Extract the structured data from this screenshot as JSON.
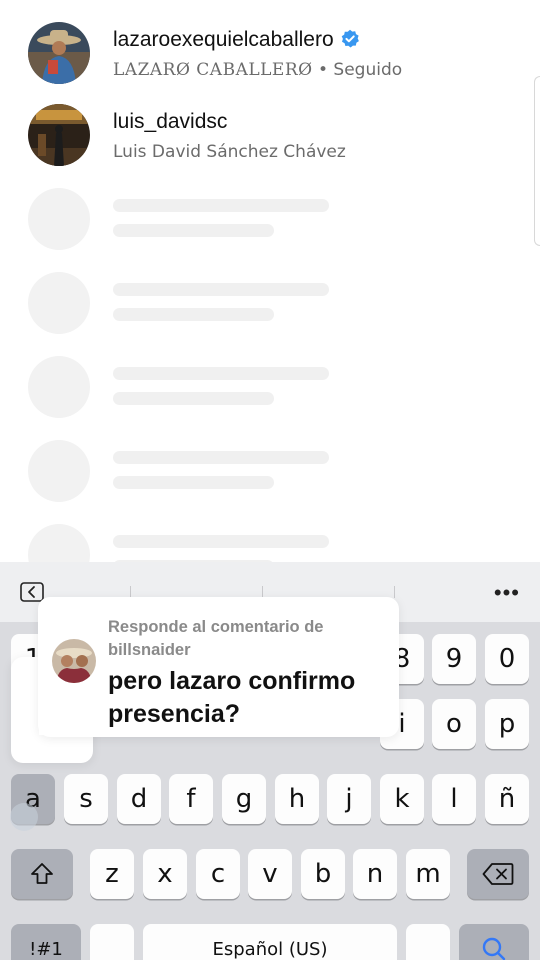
{
  "users": [
    {
      "username": "lazaroexequielcaballero",
      "verified": true,
      "display_name": "LAZARØ CABALLERØ",
      "separator": " • ",
      "status": "Seguido"
    },
    {
      "username": "luis_davidsc",
      "verified": false,
      "display_name": "Luis David Sánchez Chávez"
    }
  ],
  "keyboard": {
    "toolbar_more": "•••",
    "row1_visible": [
      "1",
      "8",
      "9",
      "0"
    ],
    "row2_visible": [
      "i",
      "o",
      "p"
    ],
    "row3": [
      "a",
      "s",
      "d",
      "f",
      "g",
      "h",
      "j",
      "k",
      "l",
      "ñ"
    ],
    "row4": [
      "z",
      "x",
      "c",
      "v",
      "b",
      "n",
      "m"
    ],
    "bottom": {
      "symbols": "!#1",
      "space": "Español (US)"
    }
  },
  "reply_tooltip": {
    "reply_to": "Responde al comentario de billsnaider",
    "comment": "pero lazaro confirmo presencia?"
  },
  "colors": {
    "verified_badge": "#3897f0",
    "secondary_text": "#6b6b6b",
    "keyboard_bg": "#dadbdf",
    "key_bg": "#fdfdfd",
    "search_icon": "#3478f6"
  }
}
